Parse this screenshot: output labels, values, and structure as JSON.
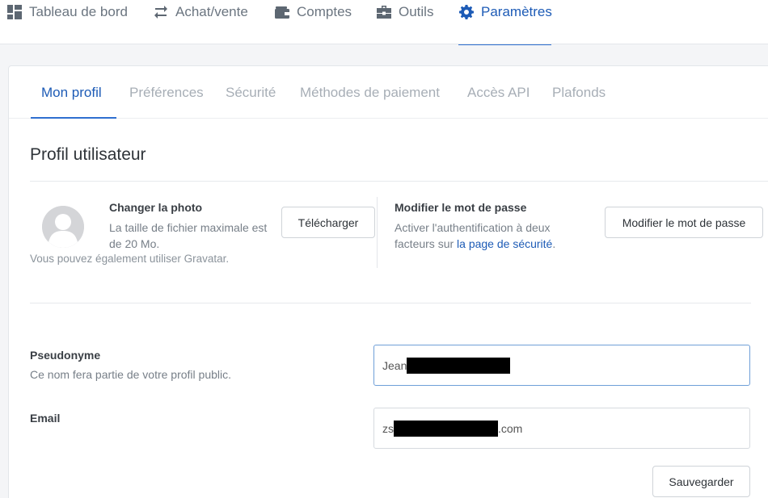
{
  "topnav": {
    "items": [
      {
        "label": "Tableau de bord",
        "icon": "dashboard-icon"
      },
      {
        "label": "Achat/vente",
        "icon": "exchange-arrows-icon"
      },
      {
        "label": "Comptes",
        "icon": "wallet-icon"
      },
      {
        "label": "Outils",
        "icon": "toolbox-icon"
      },
      {
        "label": "Paramètres",
        "icon": "gear-icon",
        "active": true
      }
    ]
  },
  "tabs": [
    {
      "label": "Mon profil",
      "active": true
    },
    {
      "label": "Préférences"
    },
    {
      "label": "Sécurité"
    },
    {
      "label": "Méthodes de paiement"
    },
    {
      "label": "Accès API"
    },
    {
      "label": "Plafonds"
    }
  ],
  "section_title": "Profil utilisateur",
  "photo": {
    "title": "Changer la photo",
    "description": "La taille de fichier maximale est de 20 Mo.",
    "gravatar_note": "Vous pouvez également utiliser Gravatar.",
    "upload_button": "Télécharger"
  },
  "password": {
    "title": "Modifier le mot de passe",
    "description_prefix": "Activer l'authentification à deux facteurs sur ",
    "link_text": "la page de sécurité",
    "description_suffix": ".",
    "button": "Modifier le mot de passe"
  },
  "form": {
    "nickname_label": "Pseudonyme",
    "nickname_help": "Ce nom fera partie de votre profil public.",
    "nickname_value_prefix": "Jean",
    "email_label": "Email",
    "email_value_prefix": "zs",
    "email_value_suffix": ".com",
    "save_button": "Sauvegarder"
  },
  "colors": {
    "accent": "#1d5bb6",
    "inactive_tab": "#a7aeb6",
    "redaction": "#000000"
  }
}
